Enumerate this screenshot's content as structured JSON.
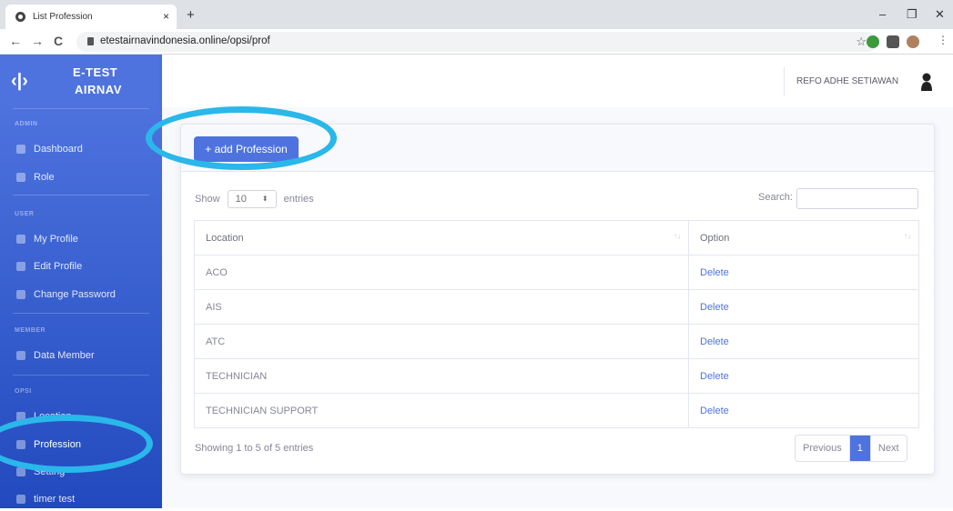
{
  "browser": {
    "tab_title": "List Profession",
    "tab_close": "×",
    "new_tab": "+",
    "url": "etestairnavindonesia.online/opsi/prof",
    "controls": {
      "minimize": "–",
      "restore": "❐",
      "close": "✕"
    },
    "nav": {
      "back": "←",
      "forward": "→",
      "reload": "C"
    }
  },
  "brand": {
    "logo": "‹|›",
    "line1": "E-TEST",
    "line2": "AIRNAV"
  },
  "sidebar": {
    "sections": [
      {
        "heading": "ADMIN",
        "items": [
          {
            "label": "Dashboard",
            "icon": "tachometer-icon"
          },
          {
            "label": "Role",
            "icon": "user-icon"
          }
        ]
      },
      {
        "heading": "USER",
        "items": [
          {
            "label": "My Profile",
            "icon": "user-icon"
          },
          {
            "label": "Edit Profile",
            "icon": "user-edit-icon"
          },
          {
            "label": "Change Password",
            "icon": "key-icon"
          }
        ]
      },
      {
        "heading": "MEMBER",
        "items": [
          {
            "label": "Data Member",
            "icon": "users-icon"
          }
        ]
      },
      {
        "heading": "OPSI",
        "items": [
          {
            "label": "Location",
            "icon": "search-location-icon"
          },
          {
            "label": "Profession",
            "icon": "user-md-icon"
          },
          {
            "label": "Setting",
            "icon": "cog-icon"
          },
          {
            "label": "timer test",
            "icon": "clock-icon"
          }
        ]
      }
    ]
  },
  "topbar": {
    "user_name": "REFO ADHE SETIAWAN"
  },
  "card": {
    "add_button": "+ add Profession"
  },
  "table_controls": {
    "show_label": "Show",
    "length_value": "10",
    "entries_label": "entries",
    "search_label": "Search:",
    "search_value": ""
  },
  "table": {
    "columns": [
      "Location",
      "Option"
    ],
    "rows": [
      {
        "location": "ACO",
        "option": "Delete"
      },
      {
        "location": "AIS",
        "option": "Delete"
      },
      {
        "location": "ATC",
        "option": "Delete"
      },
      {
        "location": "TECHNICIAN",
        "option": "Delete"
      },
      {
        "location": "TECHNICIAN SUPPORT",
        "option": "Delete"
      }
    ]
  },
  "footer": {
    "info": "Showing 1 to 5 of 5 entries",
    "previous": "Previous",
    "page": "1",
    "next": "Next"
  },
  "colors": {
    "primary": "#4e73df",
    "highlight_ring": "#2ab7ea",
    "sidebar_bottom": "#224abe"
  }
}
